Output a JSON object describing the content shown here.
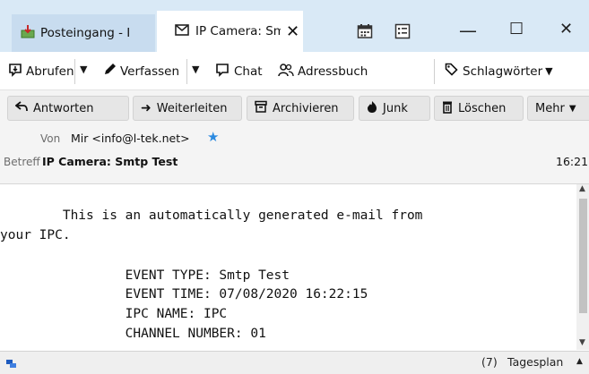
{
  "tabs": [
    {
      "label": "Posteingang - I",
      "icon": "inbox-icon",
      "active": false
    },
    {
      "label": "IP Camera: Smtp Test",
      "icon": "envelope-icon",
      "active": true
    }
  ],
  "window_controls": {
    "minimize": "—",
    "maximize": "☐",
    "close": "✕"
  },
  "toolbar": {
    "get_messages": "Abrufen",
    "compose": "Verfassen",
    "chat": "Chat",
    "address_book": "Adressbuch",
    "tags": "Schlagwörter"
  },
  "header_buttons": {
    "reply": "Antworten",
    "forward": "Weiterleiten",
    "archive": "Archivieren",
    "junk": "Junk",
    "delete": "Löschen",
    "more": "Mehr"
  },
  "header_fields": {
    "from_label": "Von",
    "from_value": "Mir <info@l-tek.net>",
    "subject_label": "Betreff",
    "subject_value": "IP Camera: Smtp Test",
    "time": "16:21"
  },
  "body": {
    "line1": "        This is an automatically generated e-mail from",
    "line2": "your IPC.",
    "line3": "",
    "line4": "                EVENT TYPE: Smtp Test",
    "line5": "                EVENT TIME: 07/08/2020 16:22:15",
    "line6": "                IPC NAME: IPC",
    "line7": "                CHANNEL NUMBER: 01"
  },
  "statusbar": {
    "agenda_badge": "(7)",
    "agenda_label": "Tagesplan"
  },
  "colors": {
    "titlebar_bg": "#d9e9f6",
    "tab_inactive_bg": "#c8dcef",
    "star": "#2b8ae0"
  }
}
